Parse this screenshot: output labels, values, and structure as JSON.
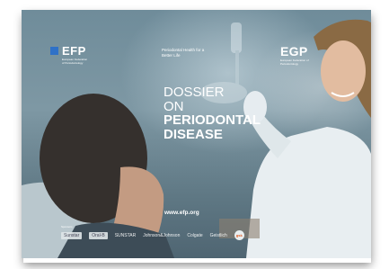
{
  "cover": {
    "left_logo": {
      "name": "EFP",
      "tagline": "European Federation of Periodontology"
    },
    "center_tagline": "Periodontal Health for a Better Life",
    "right_logo": {
      "name": "EGP",
      "tagline": "European Federation of Periodontology"
    },
    "title": {
      "line1": "DOSSIER",
      "line2": "ON",
      "line3": "PERIODONTAL",
      "line4": "DISEASE"
    },
    "url": "www.efp.org",
    "sponsors_label": "Sponsors",
    "sponsors": [
      "Sunstar",
      "Oral-B",
      "SUNSTAR",
      "Johnson&Johnson",
      "Colgate",
      "Geistlich",
      "gsk"
    ]
  }
}
